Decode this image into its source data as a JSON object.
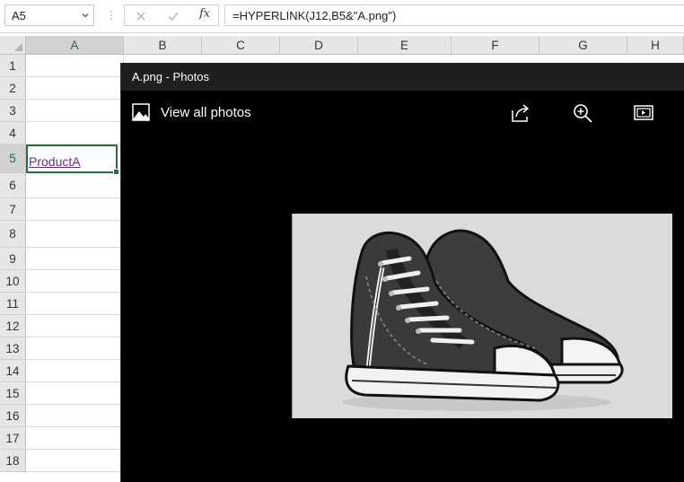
{
  "formula_bar": {
    "name_box": "A5",
    "fx_label": "fx",
    "formula": "=HYPERLINK(J12,B5&\"A.png\")"
  },
  "grid": {
    "columns": [
      "A",
      "B",
      "C",
      "D",
      "E",
      "F",
      "G",
      "H"
    ],
    "rows": [
      "1",
      "2",
      "3",
      "4",
      "5",
      "6",
      "7",
      "8",
      "9",
      "10",
      "11",
      "12",
      "13",
      "14",
      "15",
      "16",
      "17",
      "18"
    ],
    "selected_cell": "A5",
    "cell_a5_value": "ProductA"
  },
  "photos_window": {
    "title": "A.png - Photos",
    "view_all_label": "View all photos",
    "toolbar_icons": [
      "share-icon",
      "zoom-in-icon",
      "slideshow-icon"
    ],
    "image_subject": "sneakers-illustration"
  },
  "colors": {
    "selection_border": "#217346",
    "hyperlink": "#6b2b86",
    "photos_background": "#000000",
    "photos_titlebar": "#1f1f1f"
  }
}
